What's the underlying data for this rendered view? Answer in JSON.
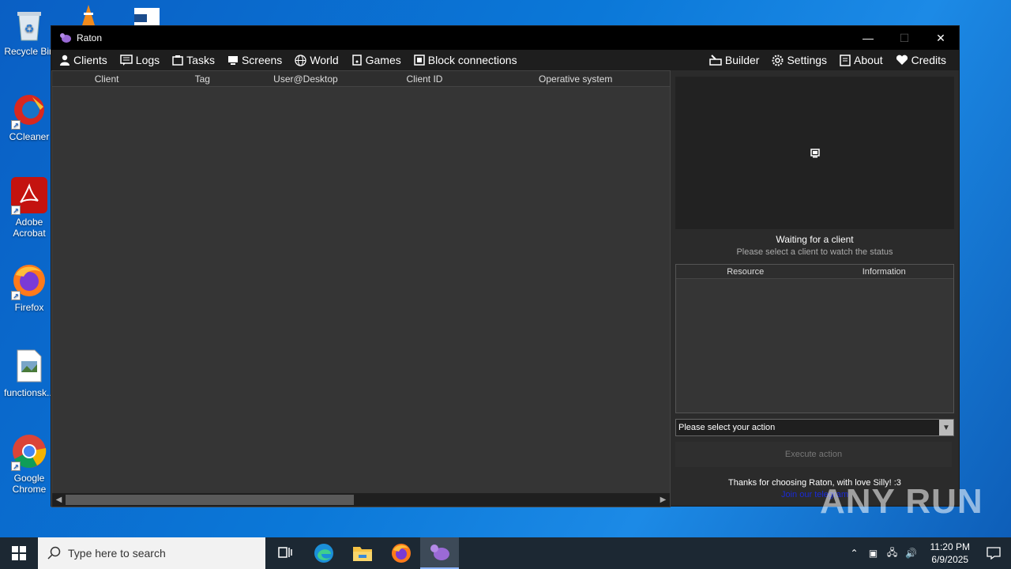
{
  "desktop": {
    "icons": [
      {
        "label": "Recycle Bin"
      },
      {
        "label": "CCleaner"
      },
      {
        "label": "Adobe Acrobat"
      },
      {
        "label": "Firefox"
      },
      {
        "label": "functionsk..."
      },
      {
        "label": "Google Chrome"
      }
    ]
  },
  "window": {
    "title": "Raton",
    "minimize": "—",
    "maximize": "☐",
    "close": "✕"
  },
  "menu": {
    "left": [
      {
        "label": "Clients",
        "icon": "user-icon"
      },
      {
        "label": "Logs",
        "icon": "logs-icon"
      },
      {
        "label": "Tasks",
        "icon": "tasks-icon"
      },
      {
        "label": "Screens",
        "icon": "screen-icon"
      },
      {
        "label": "World",
        "icon": "globe-icon"
      },
      {
        "label": "Games",
        "icon": "games-icon"
      },
      {
        "label": "Block connections",
        "icon": "block-icon"
      }
    ],
    "right": [
      {
        "label": "Builder",
        "icon": "builder-icon"
      },
      {
        "label": "Settings",
        "icon": "gear-icon"
      },
      {
        "label": "About",
        "icon": "about-icon"
      },
      {
        "label": "Credits",
        "icon": "heart-icon"
      }
    ]
  },
  "clients_table": {
    "columns": [
      "Client",
      "Tag",
      "User@Desktop",
      "Client ID",
      "Operative system"
    ]
  },
  "status": {
    "title": "Waiting for a client",
    "subtitle": "Please select a client to watch the status"
  },
  "resource_table": {
    "columns": [
      "Resource",
      "Information"
    ]
  },
  "action": {
    "selected": "Please select your action",
    "execute_label": "Execute action"
  },
  "footer": {
    "thanks": "Thanks for choosing Raton, with love Silly! :3",
    "join": "Join our telegram"
  },
  "watermark": "ANY RUN",
  "taskbar": {
    "search_placeholder": "Type here to search",
    "time": "11:20 PM",
    "date": "6/9/2025"
  }
}
